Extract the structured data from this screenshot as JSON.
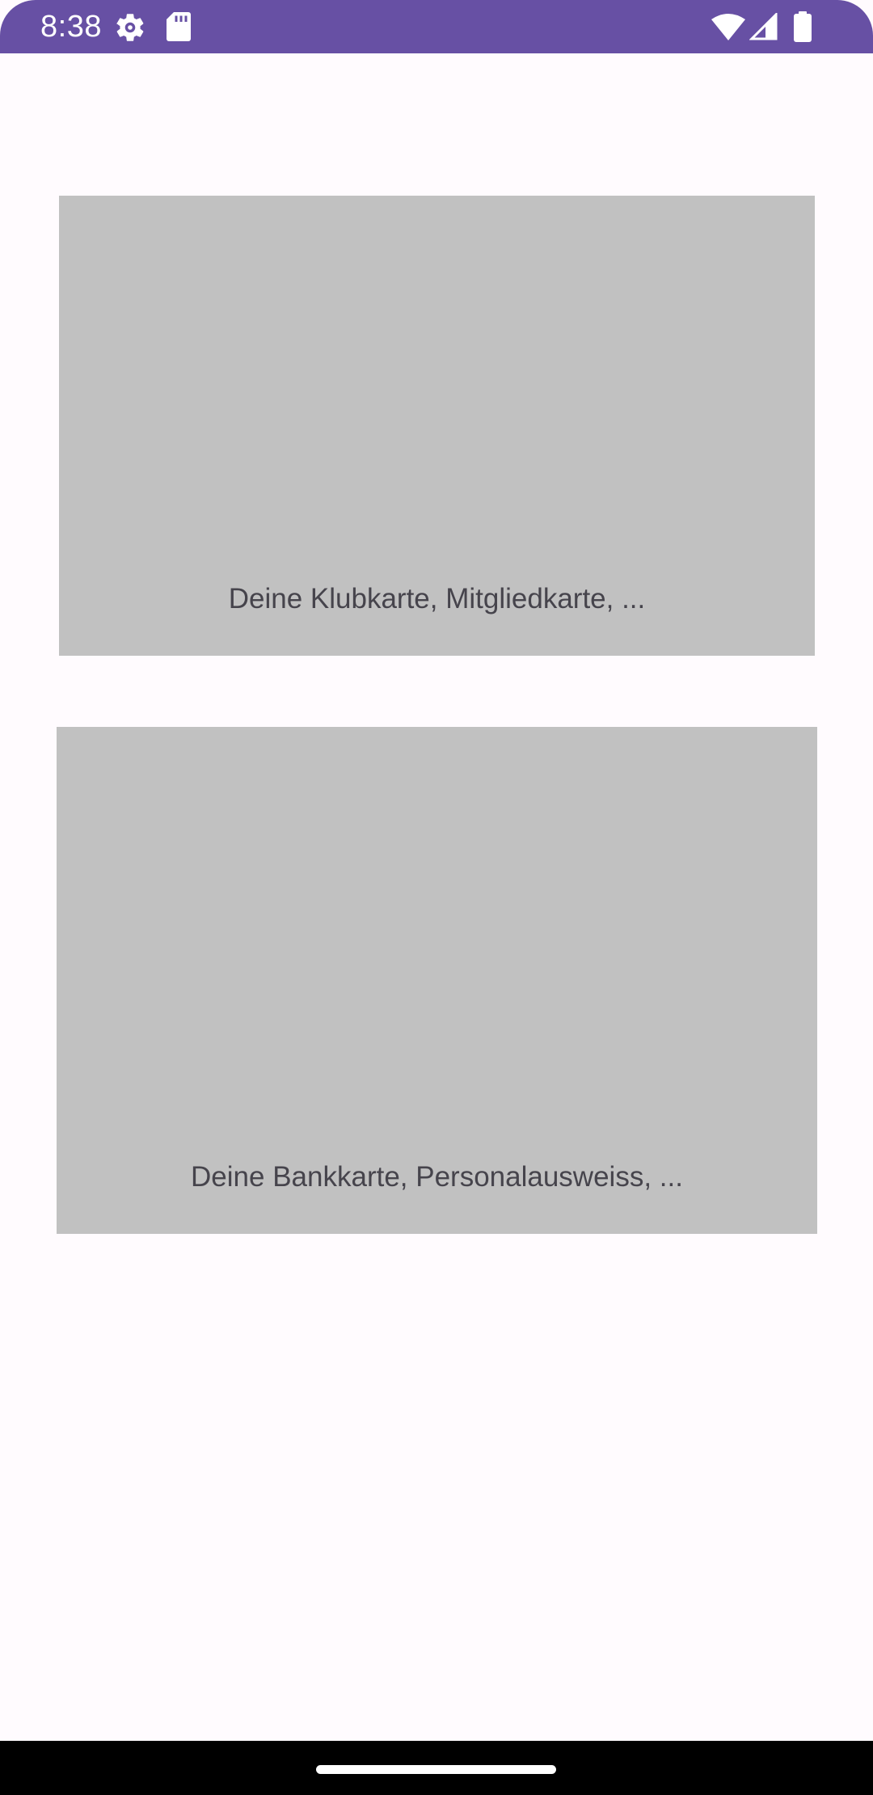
{
  "status_bar": {
    "time": "8:38",
    "background_color": "#6750A4",
    "icons_left": [
      "settings-gear-icon",
      "sd-card-icon"
    ],
    "icons_right": [
      "wifi-icon",
      "signal-icon",
      "battery-icon"
    ]
  },
  "cards": [
    {
      "label": "Deine Klubkarte, Mitgliedkarte, ..."
    },
    {
      "label": "Deine Bankkarte, Personalausweiss, ..."
    }
  ],
  "colors": {
    "background": "#FFFBFE",
    "card": "#C1C1C1",
    "card_text": "#46444C",
    "nav_bar": "#000000"
  }
}
